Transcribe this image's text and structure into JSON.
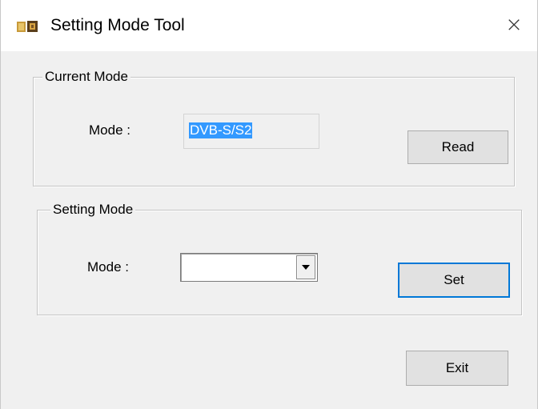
{
  "window": {
    "title": "Setting Mode Tool",
    "icon": "app-logo-icon",
    "close_glyph": "×"
  },
  "current_mode": {
    "group_label": "Current Mode",
    "mode_label": "Mode :",
    "mode_value": "DVB-S/S2",
    "read_button": "Read"
  },
  "setting_mode": {
    "group_label": "Setting Mode",
    "mode_label": "Mode :",
    "selected_value": "",
    "set_button": "Set"
  },
  "footer": {
    "exit_button": "Exit"
  },
  "colors": {
    "selection_highlight": "#3399ff",
    "focus_border": "#0078d7",
    "dialog_background": "#f0f0f0"
  }
}
